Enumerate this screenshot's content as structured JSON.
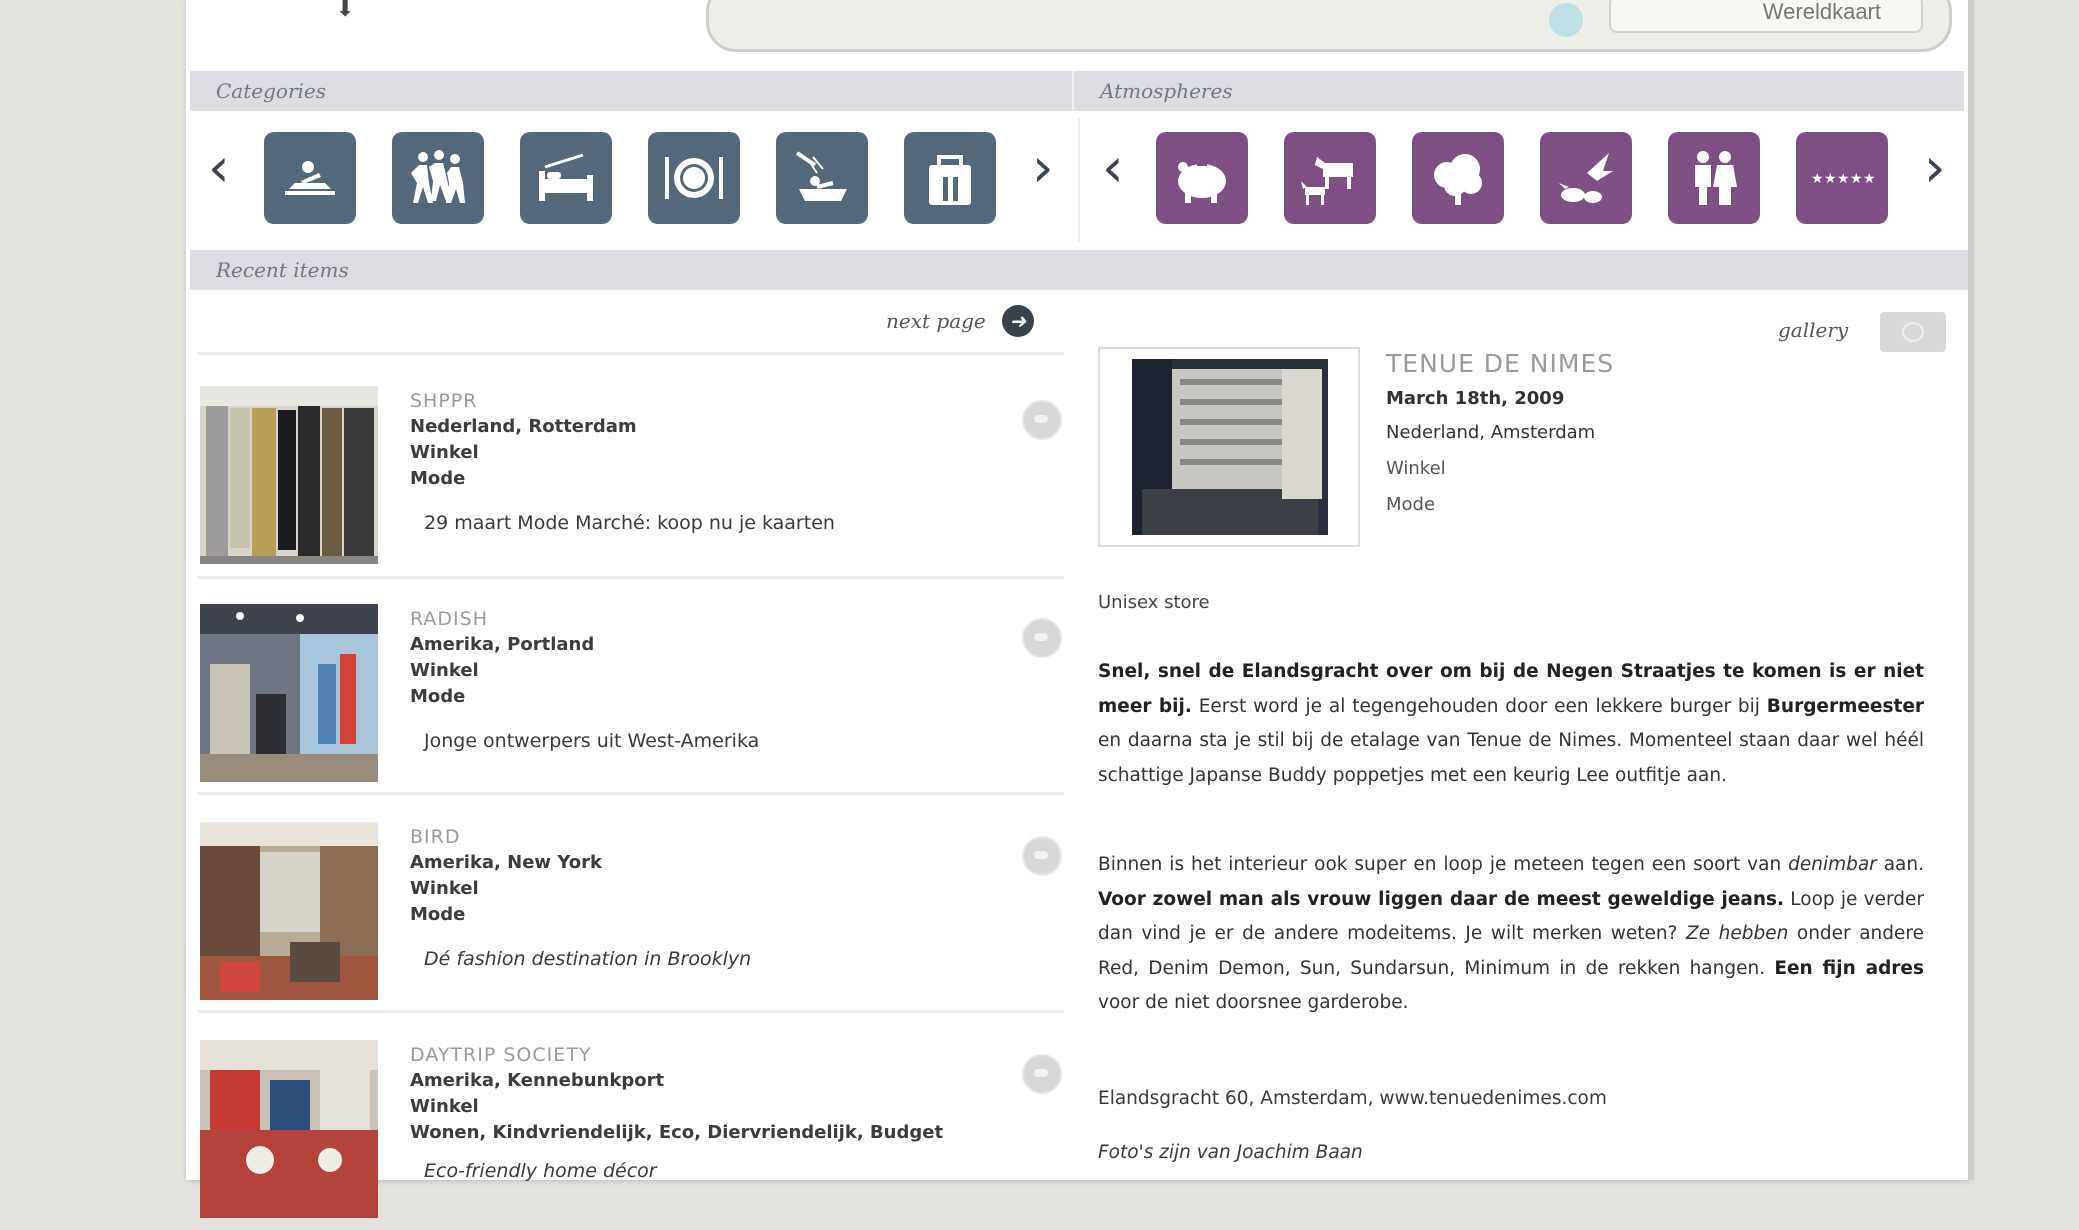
{
  "header": {
    "search_button_label": "Wereldkaart"
  },
  "categories": {
    "label": "Categories",
    "items": [
      {
        "icon": "sauna-icon"
      },
      {
        "icon": "dancing-people-icon"
      },
      {
        "icon": "bed-icon"
      },
      {
        "icon": "plate-cutlery-icon"
      },
      {
        "icon": "shower-bath-icon"
      },
      {
        "icon": "shopping-bag-icon"
      }
    ],
    "prev": "‹",
    "next": "›"
  },
  "atmospheres": {
    "label": "Atmospheres",
    "items": [
      {
        "icon": "piggy-bank-icon"
      },
      {
        "icon": "animals-icon"
      },
      {
        "icon": "tree-icon"
      },
      {
        "icon": "bird-icon"
      },
      {
        "icon": "couple-icon"
      },
      {
        "icon": "stars-icon"
      }
    ],
    "prev": "‹",
    "next": "›"
  },
  "recent": {
    "label": "Recent items",
    "next_page_label": "next page",
    "items": [
      {
        "title": "SHPPR",
        "location": "Nederland, Rotterdam",
        "type": "Winkel",
        "tags": "Mode",
        "desc": "29 maart Mode Marché: koop nu je kaarten"
      },
      {
        "title": "RADISH",
        "location": "Amerika, Portland",
        "type": "Winkel",
        "tags": "Mode",
        "desc": "Jonge ontwerpers uit West-Amerika"
      },
      {
        "title": "BIRD",
        "location": "Amerika, New York",
        "type": "Winkel",
        "tags": "Mode",
        "desc": "Dé fashion destination in Brooklyn"
      },
      {
        "title": "DAYTRIP SOCIETY",
        "location": "Amerika, Kennebunkport",
        "type": "Winkel",
        "tags": "Wonen, Kindvriendelijk, Eco, Diervriendelijk, Budget",
        "desc": "Eco-friendly home décor"
      }
    ]
  },
  "detail": {
    "gallery_label": "gallery",
    "title": "TENUE DE NIMES",
    "date": "March 18th, 2009",
    "location": "Nederland, Amsterdam",
    "type": "Winkel",
    "tags": "Mode",
    "subtitle": "Unisex store",
    "p1_bold": "Snel, snel de Elandsgracht over om bij de Negen Straatjes te komen is er niet meer bij.",
    "p1_a": " Eerst word je al tegengehouden door een lekkere burger bij ",
    "p1_bold2": "Burgermeester",
    "p1_b": " en daarna sta je stil bij de etalage van Tenue de Nimes. Momenteel staan daar wel héél schattige Japanse Buddy poppetjes met een keurig Lee outfitje aan.",
    "p2_a": "Binnen is het interieur ook super en loop je meteen tegen een soort van ",
    "p2_it": "denimbar",
    "p2_b": " aan. ",
    "p2_bold": "Voor zowel man als vrouw liggen daar de meest geweldige jeans.",
    "p2_c": " Loop je verder dan vind je er de andere modeitems. Je wilt merken weten? ",
    "p2_it2": "Ze hebben",
    "p2_d": " onder andere Red, Denim Demon, Sun, Sundarsun, Minimum in de rekken hangen. ",
    "p2_bold2": "Een fijn adres",
    "p2_e": " voor de niet doorsnee garderobe.",
    "address": "Elandsgracht 60, Amsterdam, www.tenuedenimes.com",
    "credit": "Foto's zijn van Joachim Baan"
  },
  "colors": {
    "category_tile": "#55677a",
    "atmosphere_tile": "#7e4f82",
    "section_bar": "#dcdde3"
  }
}
